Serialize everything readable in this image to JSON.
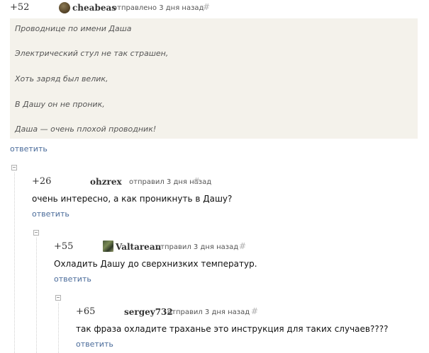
{
  "comments": [
    {
      "rating": "+52",
      "username": "cheabeas",
      "meta": "отправлено 3 дня назад",
      "hash": "#",
      "avatar_icon": "user-avatar-round",
      "quote_lines": [
        "Проводнице по имени Даша",
        "Электрический стул не так страшен,",
        "Хоть заряд был велик,",
        "В Дашу он не проник,",
        "Даша — очень плохой проводник!"
      ],
      "reply_label": "ответить"
    },
    {
      "rating": "+26",
      "username": "ohzrex",
      "meta": "отправил 3 дня назад",
      "hash": "#",
      "text": "очень интересно, а как проникнуть в Дашу?",
      "reply_label": "ответить"
    },
    {
      "rating": "+55",
      "username": "Valtarean",
      "meta": "отправил 3 дня назад",
      "hash": "#",
      "avatar_icon": "user-avatar-square",
      "text": "Охладить Дашу до сверхнизких температур.",
      "reply_label": "ответить"
    },
    {
      "rating": "+65",
      "username": "sergey732",
      "meta": "отправил 3 дня назад",
      "hash": "#",
      "text": "так фраза охладите траханье это инструкция для таких случаев????",
      "reply_label": "ответить"
    }
  ],
  "icons": {
    "collapse": "collapse-toggle-icon"
  }
}
